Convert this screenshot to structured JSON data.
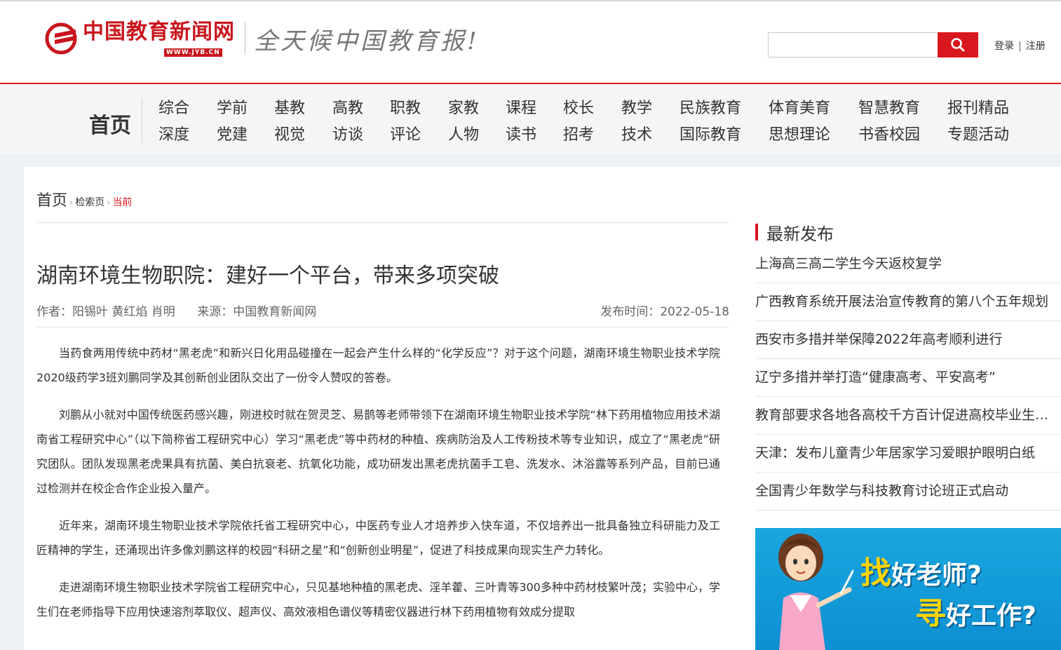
{
  "header": {
    "logo_text": "中国教育新闻网",
    "logo_url_text": "WWW.JYB.CN",
    "slogan": "全天候中国教育报!",
    "search_placeholder": "",
    "login": "登录",
    "register": "注册",
    "auth_separator": "|"
  },
  "nav": {
    "home": "首页",
    "columns": [
      [
        "综合",
        "深度"
      ],
      [
        "学前",
        "党建"
      ],
      [
        "基教",
        "视觉"
      ],
      [
        "高教",
        "访谈"
      ],
      [
        "职教",
        "评论"
      ],
      [
        "家教",
        "人物"
      ],
      [
        "课程",
        "读书"
      ],
      [
        "校长",
        "招考"
      ],
      [
        "教学",
        "技术"
      ],
      [
        "民族教育",
        "国际教育"
      ],
      [
        "体育美育",
        "思想理论"
      ],
      [
        "智慧教育",
        "书香校园"
      ],
      [
        "报刊精品",
        "专题活动"
      ]
    ]
  },
  "breadcrumb": {
    "home": "首页",
    "search_page": "检索页",
    "current": "当前"
  },
  "article": {
    "title": "湖南环境生物职院：建好一个平台，带来多项突破",
    "author": "作者：阳锡叶 黄红焰 肖明",
    "source": "来源：中国教育新闻网",
    "date": "发布时间：2022-05-18",
    "paragraphs": [
      "当药食两用传统中药材“黑老虎”和新兴日化用品碰撞在一起会产生什么样的“化学反应”？对于这个问题，湖南环境生物职业技术学院2020级药学3班刘鹏同学及其创新创业团队交出了一份令人赞叹的答卷。",
      "刘鹏从小就对中国传统医药感兴趣，刚进校时就在贺灵芝、易鹊等老师带领下在湖南环境生物职业技术学院“林下药用植物应用技术湖南省工程研究中心”（以下简称省工程研究中心）学习“黑老虎”等中药材的种植、疾病防治及人工传粉技术等专业知识，成立了“黑老虎”研究团队。团队发现黑老虎果具有抗菌、美白抗衰老、抗氧化功能，成功研发出黑老虎抗菌手工皂、洗发水、沐浴露等系列产品，目前已通过检测并在校企合作企业投入量产。",
      "近年来，湖南环境生物职业技术学院依托省工程研究中心，中医药专业人才培养步入快车道，不仅培养出一批具备独立科研能力及工匠精神的学生，还涌现出许多像刘鹏这样的校园“科研之星”和“创新创业明星”，促进了科技成果向现实生产力转化。",
      "走进湖南环境生物职业技术学院省工程研究中心，只见基地种植的黑老虎、淫羊藿、三叶青等300多种中药材枝繁叶茂；实验中心，学生们在老师指导下应用快速溶剂萃取仪、超声仪、高效液相色谱仪等精密仪器进行林下药用植物有效成分提取"
    ]
  },
  "sidebar": {
    "title": "最新发布",
    "items": [
      "上海高三高二学生今天返校复学",
      "广西教育系统开展法治宣传教育的第八个五年规划",
      "西安市多措并举保障2022年高考顺利进行",
      "辽宁多措并举打造“健康高考、平安高考”",
      "教育部要求各地各高校千方百计促进高校毕业生就业",
      "天津：发布儿童青少年居家学习爱眼护眼明白纸",
      "全国青少年数学与科技教育讨论班正式启动"
    ],
    "banner": {
      "line1_highlight": "找",
      "line1_rest": "好老师?",
      "line2_highlight": "寻",
      "line2_rest": "好工作?"
    }
  },
  "colors": {
    "brand_red": "#d9171e",
    "banner_blue": "#1aa6e0"
  }
}
